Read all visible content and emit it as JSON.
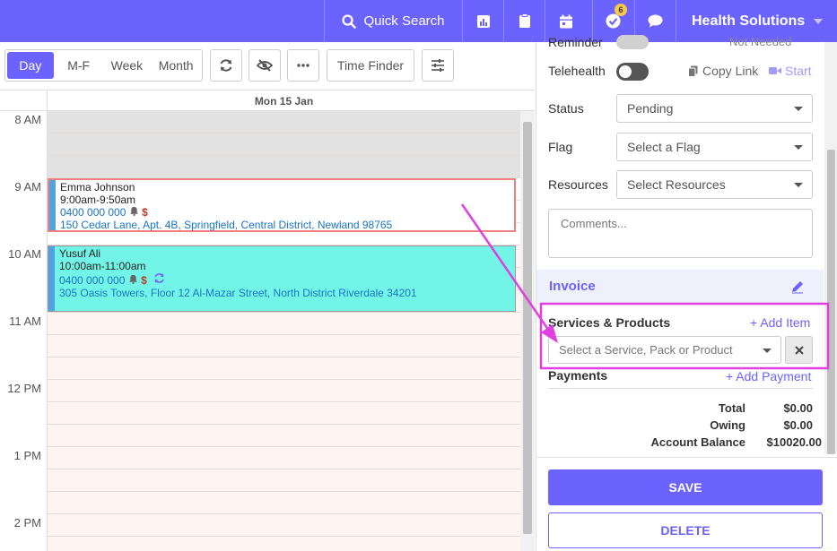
{
  "topbar": {
    "search_label": "Quick Search",
    "tasks_badge": "6",
    "org_name": "Health Solutions",
    "bg_color": "#6c63ff"
  },
  "toolbar": {
    "views": [
      "Day",
      "M-F",
      "Week",
      "Month"
    ],
    "active_view": "Day",
    "time_finder_label": "Time Finder"
  },
  "calendar": {
    "day_header": "Mon 15 Jan",
    "hours": [
      "8 AM",
      "9 AM",
      "10 AM",
      "11 AM",
      "12 PM",
      "1 PM",
      "2 PM"
    ],
    "appointments": [
      {
        "name": "Emma Johnson",
        "time": "9:00am-9:50am",
        "phone": "0400 000 000",
        "address": "150 Cedar Lane, Apt. 4B, Springfield, Central District, Newland 98765"
      },
      {
        "name": "Yusuf Ali",
        "time": "10:00am-11:00am",
        "phone": "0400 000 000",
        "address": "305 Oasis Towers, Floor 12 Al-Mazar Street, North District Riverdale 34201"
      }
    ]
  },
  "panel": {
    "reminder_label": "Reminder",
    "reminder_note": "Not Needed",
    "telehealth_label": "Telehealth",
    "copy_link_label": "Copy Link",
    "start_label": "Start",
    "status_label": "Status",
    "status_value": "Pending",
    "flag_label": "Flag",
    "flag_placeholder": "Select a Flag",
    "resources_label": "Resources",
    "resources_placeholder": "Select Resources",
    "comments_placeholder": "Comments...",
    "invoice_title": "Invoice",
    "services_title": "Services & Products",
    "add_item_label": "+ Add Item",
    "service_placeholder": "Select a Service, Pack or Product",
    "payments_title": "Payments",
    "add_payment_label": "+ Add Payment",
    "totals": [
      {
        "label": "Total",
        "value": "$0.00"
      },
      {
        "label": "Owing",
        "value": "$0.00"
      },
      {
        "label": "Account Balance",
        "value": "$10020.00"
      }
    ],
    "save_label": "SAVE",
    "delete_label": "DELETE"
  }
}
